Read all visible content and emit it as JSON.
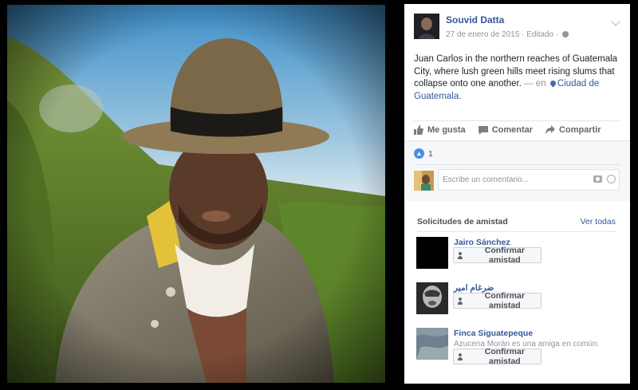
{
  "post": {
    "author_name": "Souvid Datta",
    "date": "27 de enero de 2015",
    "edited": "· Editado ·",
    "caption_text": "Juan Carlos in the northern reaches of Guatemala City, where lush green hills meet rising slums that collapse onto one another.",
    "caption_dash": " — en ",
    "location": "Ciudad de Guatemala",
    "location_suffix": "."
  },
  "actions": {
    "like_label": "Me gusta",
    "comment_label": "Comentar",
    "share_label": "Compartir"
  },
  "reactions": {
    "like_count": "1"
  },
  "comment_box": {
    "placeholder": "Escribe un comentario..."
  },
  "friend_requests": {
    "title": "Solicitudes de amistad",
    "see_all": "Ver todas",
    "confirm_label": "Confirmar amistad",
    "items": [
      {
        "name": "Jairo Sánchez",
        "mutual": ""
      },
      {
        "name": "ضرغام امير",
        "mutual": ""
      },
      {
        "name": "Finca Siguatepeque",
        "mutual": "Azucena Morán es una amiga en común."
      }
    ]
  },
  "colors": {
    "link_blue": "#365899",
    "like_blue": "#4a90e2",
    "muted_gray": "#90949c"
  }
}
